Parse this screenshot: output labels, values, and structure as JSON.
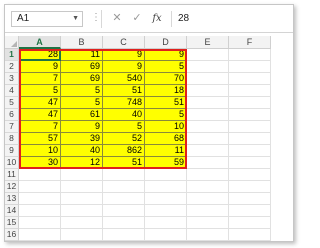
{
  "formula_bar": {
    "name_box": "A1",
    "cancel_symbol": "✕",
    "enter_symbol": "✓",
    "fx_label": "fx",
    "formula_value": "28"
  },
  "columns": [
    "A",
    "B",
    "C",
    "D",
    "E",
    "F"
  ],
  "selected_column": "A",
  "rows": [
    "1",
    "2",
    "3",
    "4",
    "5",
    "6",
    "7",
    "8",
    "9",
    "10",
    "11",
    "12",
    "13",
    "14",
    "15",
    "16"
  ],
  "selected_row": "1",
  "cells": [
    [
      "28",
      "11",
      "9",
      "9"
    ],
    [
      "9",
      "69",
      "9",
      "5"
    ],
    [
      "7",
      "69",
      "540",
      "70"
    ],
    [
      "5",
      "5",
      "51",
      "18"
    ],
    [
      "47",
      "5",
      "748",
      "51"
    ],
    [
      "47",
      "61",
      "40",
      "5"
    ],
    [
      "7",
      "9",
      "5",
      "10"
    ],
    [
      "57",
      "39",
      "52",
      "68"
    ],
    [
      "10",
      "40",
      "862",
      "11"
    ],
    [
      "30",
      "12",
      "51",
      "59"
    ]
  ],
  "colors": {
    "fill": "#ffff00",
    "range_border": "#e0201c",
    "active_accent": "#217346"
  }
}
